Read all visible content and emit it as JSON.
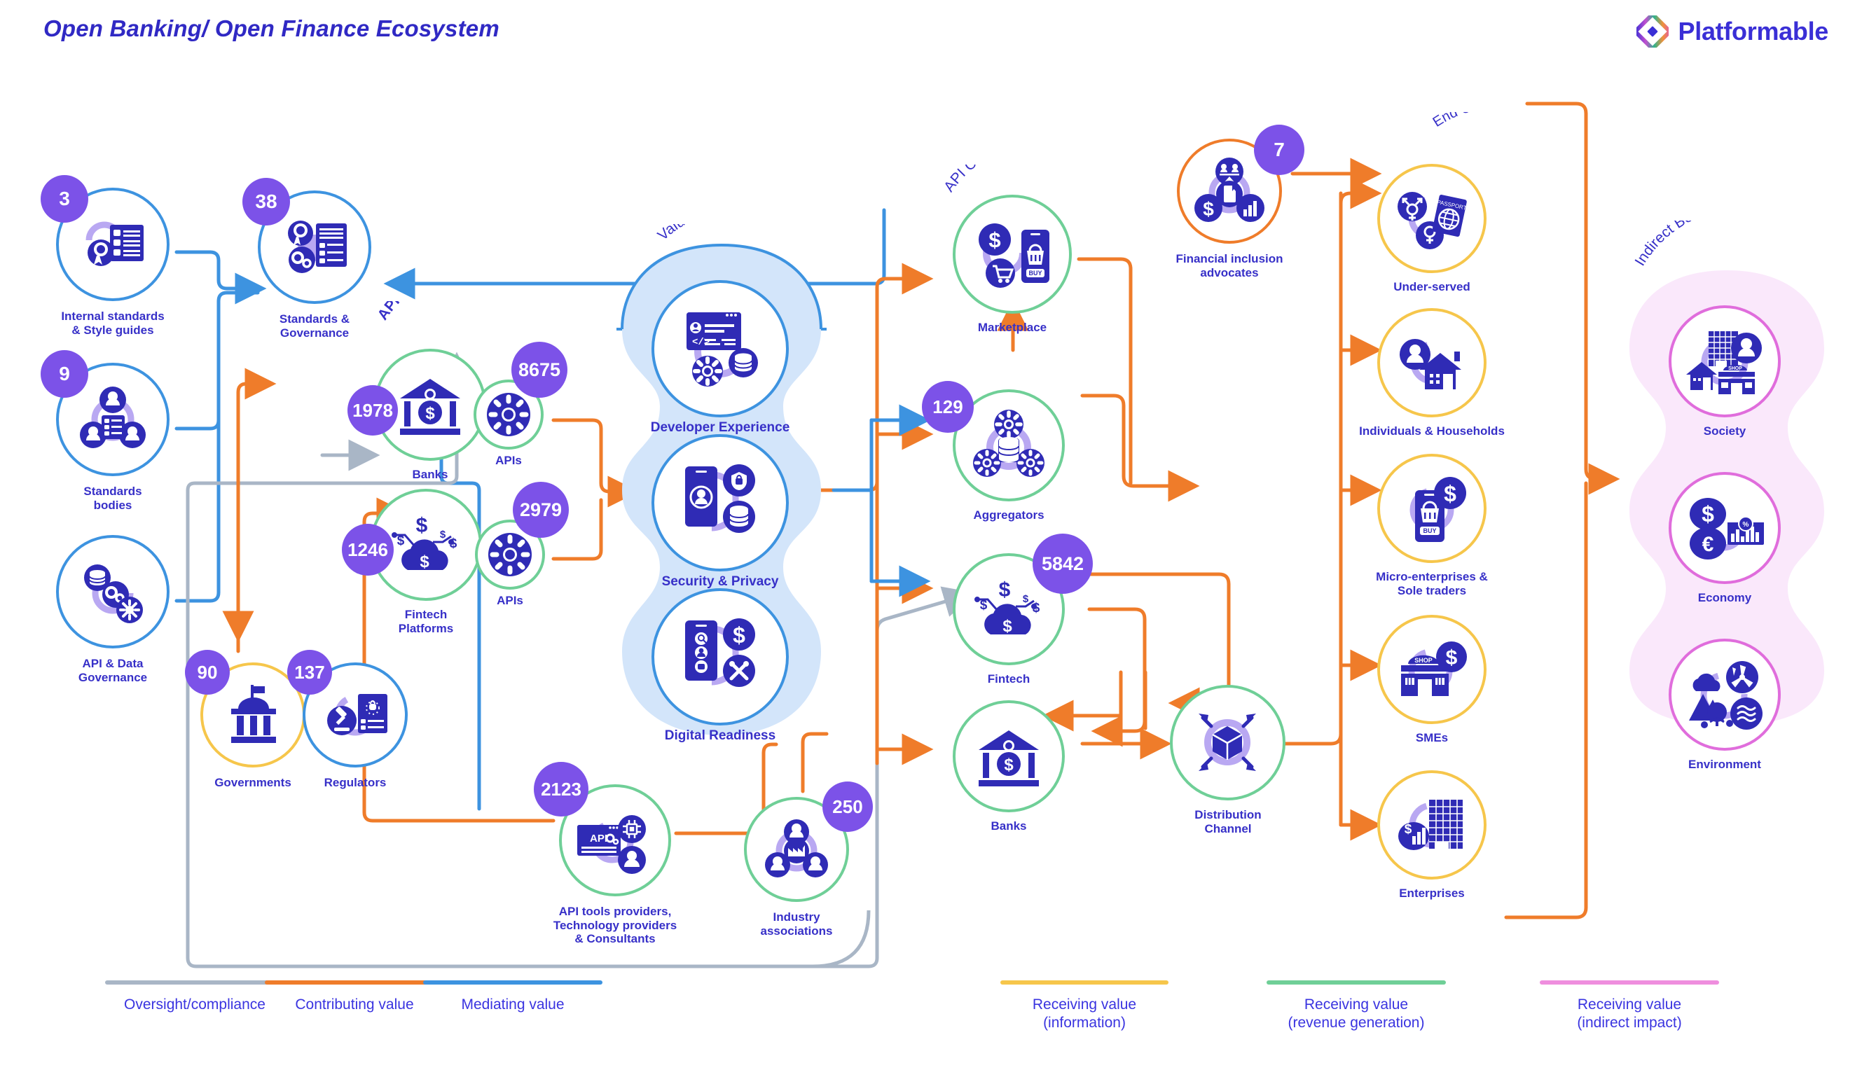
{
  "header": {
    "title": "Open Banking/ Open Finance Ecosystem",
    "logo_text": "Platformable",
    "logo_icon": "diamond-gradient-logo"
  },
  "group_labels": {
    "api_providers": "API Providers",
    "value_enablers": "Value Enablers",
    "api_consumers": "API Consumers",
    "end_users": "End Users",
    "indirect_beneficiaries": "Indirect Beneficiaries"
  },
  "nodes": [
    {
      "id": "internal-standards",
      "label": "Internal standards\n& Style guides",
      "count": "3",
      "ring": "blue",
      "icon": "checklist-award-icon"
    },
    {
      "id": "standards-bodies",
      "label": "Standards\nbodies",
      "count": "9",
      "ring": "blue",
      "icon": "people-document-icon"
    },
    {
      "id": "api-data-governance",
      "label": "API & Data\nGovernance",
      "count": null,
      "ring": "blue",
      "icon": "database-gears-icon"
    },
    {
      "id": "standards-governance",
      "label": "Standards &\nGovernance",
      "count": "38",
      "ring": "blue",
      "icon": "award-gears-document-icon"
    },
    {
      "id": "governments",
      "label": "Governments",
      "count": "90",
      "ring": "yellow",
      "icon": "government-building-icon"
    },
    {
      "id": "regulators",
      "label": "Regulators",
      "count": "137",
      "ring": "blue",
      "icon": "gavel-regulation-icon"
    },
    {
      "id": "banks-provider",
      "label": "Banks",
      "count": "1978",
      "ring": "green",
      "icon": "bank-dollar-icon"
    },
    {
      "id": "banks-apis",
      "label": "APIs",
      "count": "8675",
      "ring": "green",
      "icon": "gear-icon"
    },
    {
      "id": "fintech-platforms",
      "label": "Fintech\nPlatforms",
      "count": "1246",
      "ring": "green",
      "icon": "cloud-money-icon"
    },
    {
      "id": "fintech-apis",
      "label": "APIs",
      "count": "2979",
      "ring": "green",
      "icon": "gear-icon"
    },
    {
      "id": "api-tools-providers",
      "label": "API tools providers,\nTechnology providers\n& Consultants",
      "count": "2123",
      "ring": "green",
      "icon": "api-window-chip-icon"
    },
    {
      "id": "industry-associations",
      "label": "Industry\nassociations",
      "count": "250",
      "ring": "green",
      "icon": "people-factory-icon"
    },
    {
      "id": "developer-experience",
      "label": "Developer Experience",
      "count": null,
      "ring": "blue",
      "icon": "code-window-database-icon"
    },
    {
      "id": "security-privacy",
      "label": "Security & Privacy",
      "count": null,
      "ring": "blue",
      "icon": "phone-lock-database-icon"
    },
    {
      "id": "digital-readiness",
      "label": "Digital Readiness",
      "count": null,
      "ring": "blue",
      "icon": "phone-tools-dollar-icon"
    },
    {
      "id": "marketplace",
      "label": "Marketplace",
      "count": null,
      "ring": "green",
      "icon": "cart-buy-phone-icon"
    },
    {
      "id": "aggregators",
      "label": "Aggregators",
      "count": "129",
      "ring": "green",
      "icon": "gears-database-icon"
    },
    {
      "id": "fintech-consumer",
      "label": "Fintech",
      "count": "5842",
      "ring": "green",
      "icon": "cloud-money-icon"
    },
    {
      "id": "banks-consumer",
      "label": "Banks",
      "count": null,
      "ring": "green",
      "icon": "bank-dollar-icon"
    },
    {
      "id": "distribution-channel",
      "label": "Distribution\nChannel",
      "count": null,
      "ring": "green",
      "icon": "box-arrows-icon"
    },
    {
      "id": "financial-inclusion-advocates",
      "label": "Financial inclusion\nadvocates",
      "count": "7",
      "ring": "orange",
      "icon": "inclusion-balance-icon"
    },
    {
      "id": "under-served",
      "label": "Under-served",
      "count": null,
      "ring": "yellow",
      "icon": "gender-passport-icon"
    },
    {
      "id": "individuals-households",
      "label": "Individuals & Households",
      "count": null,
      "ring": "yellow",
      "icon": "person-house-icon"
    },
    {
      "id": "micro-enterprises",
      "label": "Micro-enterprises &\nSole traders",
      "count": null,
      "ring": "yellow",
      "icon": "phone-buy-dollar-icon"
    },
    {
      "id": "smes",
      "label": "SMEs",
      "count": null,
      "ring": "yellow",
      "icon": "shop-dollar-icon"
    },
    {
      "id": "enterprises",
      "label": "Enterprises",
      "count": null,
      "ring": "yellow",
      "icon": "tower-chart-icon"
    },
    {
      "id": "society",
      "label": "Society",
      "count": null,
      "ring": "pink",
      "icon": "house-shop-person-icon"
    },
    {
      "id": "economy",
      "label": "Economy",
      "count": null,
      "ring": "pink",
      "icon": "dollar-euro-chart-icon"
    },
    {
      "id": "environment",
      "label": "Environment",
      "count": null,
      "ring": "pink",
      "icon": "nature-wind-water-icon"
    }
  ],
  "legend": [
    {
      "label": "Oversight/compliance",
      "color": "#a9b6c6"
    },
    {
      "label": "Contributing value",
      "color": "#ef7c2a"
    },
    {
      "label": "Mediating value",
      "color": "#3d93e0"
    },
    {
      "label": "Receiving value\n(information)",
      "color": "#f6c64b"
    },
    {
      "label": "Receiving value\n(revenue generation)",
      "color": "#6fcf97"
    },
    {
      "label": "Receiving value\n(indirect impact)",
      "color": "#ef8ede"
    }
  ],
  "colors": {
    "navy": "#2f2bb5",
    "purple": "#7c52e8",
    "blue": "#3d93e0",
    "orange": "#ef7c2a",
    "green": "#6fcf97",
    "yellow": "#f6c64b",
    "pink": "#ef8ede",
    "grey": "#a9b6c6",
    "lilac": "#b9a8f2",
    "pale_blue": "#d3e5fa",
    "pale_pink": "#fae8fb"
  }
}
